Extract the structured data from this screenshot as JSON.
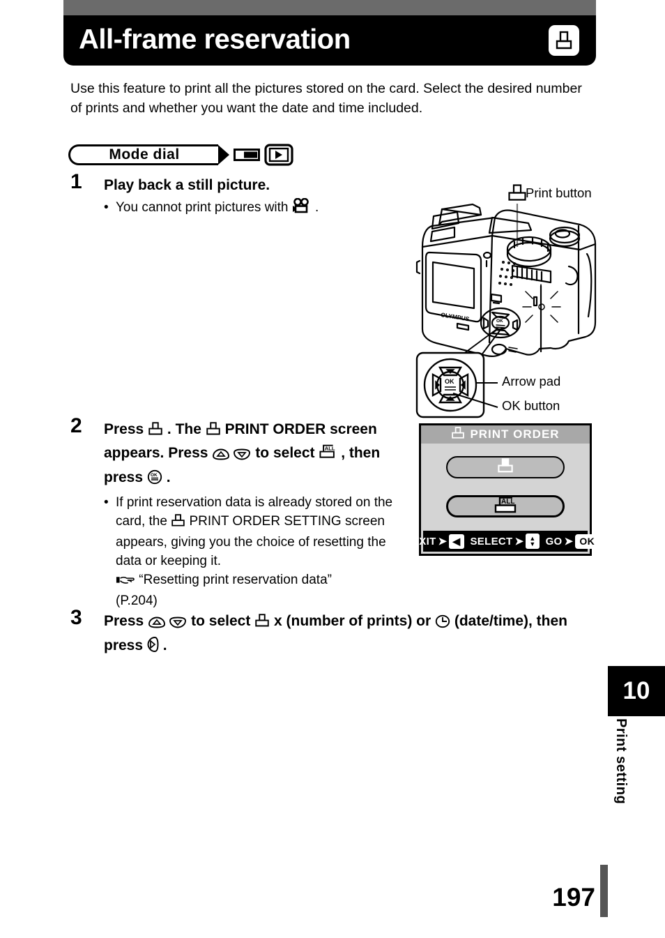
{
  "header": {
    "title": "All-frame reservation",
    "icon": "print-icon"
  },
  "intro": "Use this feature to print all the pictures stored on the card. Select the desired number of prints and whether you want the date and time included.",
  "mode_dial": {
    "label": "Mode dial",
    "icons": [
      "card-icon",
      "playback-icon"
    ]
  },
  "steps": [
    {
      "number": "1",
      "heading": "Play back a still picture.",
      "bullets": [
        {
          "before": "You cannot print pictures with ",
          "icon": "movie-icon",
          "after": " ."
        }
      ]
    },
    {
      "number": "2",
      "heading_parts": {
        "p1": "Press ",
        "p2": " . The ",
        "p3": " PRINT ORDER screen appears. Press ",
        "p4": " to select ",
        "p5": " , then press ",
        "p6": " ."
      },
      "bullets": [
        {
          "t1": "If print reservation data is already stored on the card, the ",
          "t2": " PRINT ORDER SETTING screen appears, giving you the choice of resetting the data or keeping it.",
          "ref_text": "“Resetting print reservation data”",
          "ref_page": "(P.204)"
        }
      ]
    },
    {
      "number": "3",
      "heading_parts": {
        "p1": "Press ",
        "p2": " to select ",
        "p3": " x (number of prints) or ",
        "p4": " (date/time), then press ",
        "p5": " ."
      }
    }
  ],
  "camera_figure": {
    "print_button_label": "Print button",
    "arrow_pad_label": "Arrow pad",
    "ok_button_label": "OK button",
    "lcd_brand": "OLYMPUS"
  },
  "lcd_screen": {
    "title": "PRINT ORDER",
    "items": [
      {
        "icon": "single-print-icon",
        "label": ""
      },
      {
        "icon": "all-print-icon",
        "label": "ALL"
      }
    ],
    "guide": [
      {
        "label": "EXIT",
        "key": "◀"
      },
      {
        "label": "SELECT",
        "key": "updown"
      },
      {
        "label": "GO",
        "key": "OK"
      }
    ]
  },
  "sidebar": {
    "chapter_number": "10",
    "chapter_label": "Print setting"
  },
  "page_number": "197",
  "colors": {
    "header_bg": "#000000",
    "top_band": "#6b6b6b",
    "lcd_title_bg": "#a8a8a8",
    "lcd_body_bg": "#d4d4d4",
    "lcd_item_bg": "#bcbcbc"
  }
}
